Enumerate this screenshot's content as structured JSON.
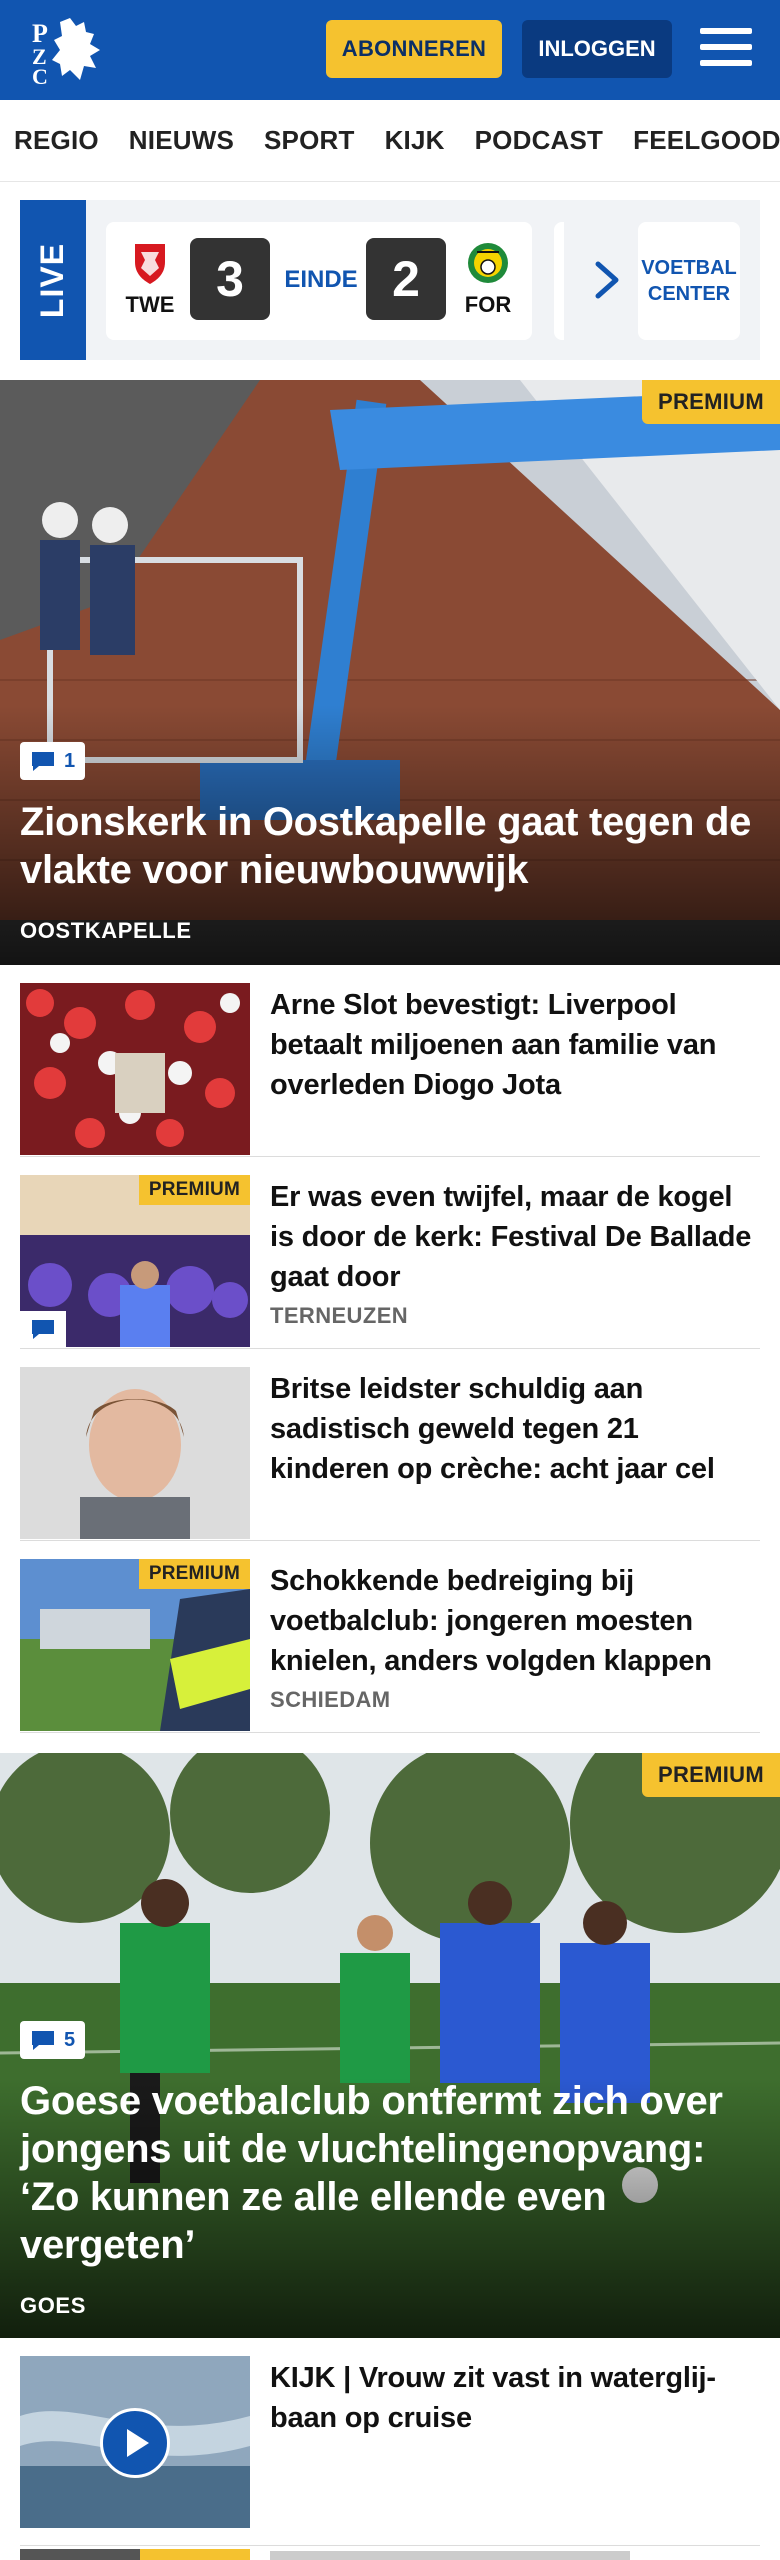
{
  "header": {
    "logo_text": "PZC",
    "subscribe_label": "ABONNEREN",
    "login_label": "INLOGGEN",
    "menu_icon": "hamburger-icon"
  },
  "nav": {
    "items": [
      "REGIO",
      "NIEUWS",
      "SPORT",
      "KIJK",
      "PODCAST",
      "FEELGOOD"
    ]
  },
  "live": {
    "badge": "LIVE",
    "home_abbr": "TWE",
    "away_abbr": "FOR",
    "home_score": "3",
    "away_score": "2",
    "status": "EINDE",
    "center_label_1": "VOETBAL",
    "center_label_2": "CENTER"
  },
  "hero1": {
    "premium": "PREMIUM",
    "comments": "1",
    "title": "Zionskerk in Oostkapelle gaat tegen de vlakte voor nieuwbouwwijk",
    "location": "OOSTKAPELLE"
  },
  "articles": [
    {
      "title": "Arne Slot bevestigt: Liverpool betaalt miljoenen aan familie van overleden Diogo Jota",
      "location": "",
      "premium": ""
    },
    {
      "title": "Er was even twijfel, maar de kogel is door de kerk: Festival De Ballade gaat door",
      "location": "TERNEUZEN",
      "premium": "PREMIUM"
    },
    {
      "title": "Britse leidster schuldig aan sadistisch geweld tegen 21 kinderen op crèche: acht jaar cel",
      "location": "",
      "premium": ""
    },
    {
      "title": "Schokkende bedreiging bij voetbalclub: jongeren moesten knielen, anders volgden klappen",
      "location": "SCHIEDAM",
      "premium": "PREMIUM"
    }
  ],
  "hero2": {
    "premium": "PREMIUM",
    "comments": "5",
    "title": "Goese voetbalclub ontfermt zich over jongens uit de vluchtelingenopvang: ‘Zo kunnen ze alle ellende even vergeten’",
    "location": "GOES"
  },
  "video_article": {
    "title": "KIJK | Vrouw zit vast in waterglij-baan op cruise"
  },
  "colors": {
    "brand_blue": "#1155b0",
    "premium_yellow": "#f5c22f",
    "dark_blue": "#0a3a80"
  }
}
